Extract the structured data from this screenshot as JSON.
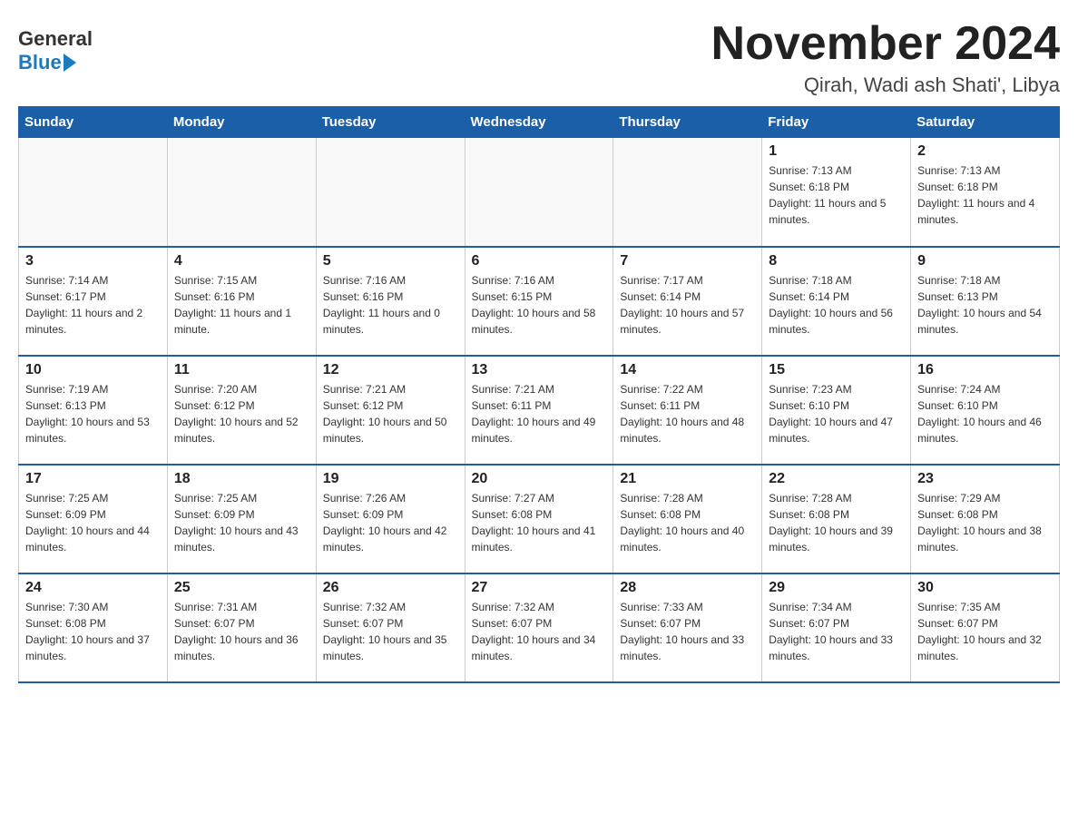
{
  "header": {
    "logo_general": "General",
    "logo_blue": "Blue",
    "month_title": "November 2024",
    "location": "Qirah, Wadi ash Shati', Libya"
  },
  "weekdays": [
    "Sunday",
    "Monday",
    "Tuesday",
    "Wednesday",
    "Thursday",
    "Friday",
    "Saturday"
  ],
  "weeks": [
    [
      {
        "day": "",
        "sunrise": "",
        "sunset": "",
        "daylight": ""
      },
      {
        "day": "",
        "sunrise": "",
        "sunset": "",
        "daylight": ""
      },
      {
        "day": "",
        "sunrise": "",
        "sunset": "",
        "daylight": ""
      },
      {
        "day": "",
        "sunrise": "",
        "sunset": "",
        "daylight": ""
      },
      {
        "day": "",
        "sunrise": "",
        "sunset": "",
        "daylight": ""
      },
      {
        "day": "1",
        "sunrise": "Sunrise: 7:13 AM",
        "sunset": "Sunset: 6:18 PM",
        "daylight": "Daylight: 11 hours and 5 minutes."
      },
      {
        "day": "2",
        "sunrise": "Sunrise: 7:13 AM",
        "sunset": "Sunset: 6:18 PM",
        "daylight": "Daylight: 11 hours and 4 minutes."
      }
    ],
    [
      {
        "day": "3",
        "sunrise": "Sunrise: 7:14 AM",
        "sunset": "Sunset: 6:17 PM",
        "daylight": "Daylight: 11 hours and 2 minutes."
      },
      {
        "day": "4",
        "sunrise": "Sunrise: 7:15 AM",
        "sunset": "Sunset: 6:16 PM",
        "daylight": "Daylight: 11 hours and 1 minute."
      },
      {
        "day": "5",
        "sunrise": "Sunrise: 7:16 AM",
        "sunset": "Sunset: 6:16 PM",
        "daylight": "Daylight: 11 hours and 0 minutes."
      },
      {
        "day": "6",
        "sunrise": "Sunrise: 7:16 AM",
        "sunset": "Sunset: 6:15 PM",
        "daylight": "Daylight: 10 hours and 58 minutes."
      },
      {
        "day": "7",
        "sunrise": "Sunrise: 7:17 AM",
        "sunset": "Sunset: 6:14 PM",
        "daylight": "Daylight: 10 hours and 57 minutes."
      },
      {
        "day": "8",
        "sunrise": "Sunrise: 7:18 AM",
        "sunset": "Sunset: 6:14 PM",
        "daylight": "Daylight: 10 hours and 56 minutes."
      },
      {
        "day": "9",
        "sunrise": "Sunrise: 7:18 AM",
        "sunset": "Sunset: 6:13 PM",
        "daylight": "Daylight: 10 hours and 54 minutes."
      }
    ],
    [
      {
        "day": "10",
        "sunrise": "Sunrise: 7:19 AM",
        "sunset": "Sunset: 6:13 PM",
        "daylight": "Daylight: 10 hours and 53 minutes."
      },
      {
        "day": "11",
        "sunrise": "Sunrise: 7:20 AM",
        "sunset": "Sunset: 6:12 PM",
        "daylight": "Daylight: 10 hours and 52 minutes."
      },
      {
        "day": "12",
        "sunrise": "Sunrise: 7:21 AM",
        "sunset": "Sunset: 6:12 PM",
        "daylight": "Daylight: 10 hours and 50 minutes."
      },
      {
        "day": "13",
        "sunrise": "Sunrise: 7:21 AM",
        "sunset": "Sunset: 6:11 PM",
        "daylight": "Daylight: 10 hours and 49 minutes."
      },
      {
        "day": "14",
        "sunrise": "Sunrise: 7:22 AM",
        "sunset": "Sunset: 6:11 PM",
        "daylight": "Daylight: 10 hours and 48 minutes."
      },
      {
        "day": "15",
        "sunrise": "Sunrise: 7:23 AM",
        "sunset": "Sunset: 6:10 PM",
        "daylight": "Daylight: 10 hours and 47 minutes."
      },
      {
        "day": "16",
        "sunrise": "Sunrise: 7:24 AM",
        "sunset": "Sunset: 6:10 PM",
        "daylight": "Daylight: 10 hours and 46 minutes."
      }
    ],
    [
      {
        "day": "17",
        "sunrise": "Sunrise: 7:25 AM",
        "sunset": "Sunset: 6:09 PM",
        "daylight": "Daylight: 10 hours and 44 minutes."
      },
      {
        "day": "18",
        "sunrise": "Sunrise: 7:25 AM",
        "sunset": "Sunset: 6:09 PM",
        "daylight": "Daylight: 10 hours and 43 minutes."
      },
      {
        "day": "19",
        "sunrise": "Sunrise: 7:26 AM",
        "sunset": "Sunset: 6:09 PM",
        "daylight": "Daylight: 10 hours and 42 minutes."
      },
      {
        "day": "20",
        "sunrise": "Sunrise: 7:27 AM",
        "sunset": "Sunset: 6:08 PM",
        "daylight": "Daylight: 10 hours and 41 minutes."
      },
      {
        "day": "21",
        "sunrise": "Sunrise: 7:28 AM",
        "sunset": "Sunset: 6:08 PM",
        "daylight": "Daylight: 10 hours and 40 minutes."
      },
      {
        "day": "22",
        "sunrise": "Sunrise: 7:28 AM",
        "sunset": "Sunset: 6:08 PM",
        "daylight": "Daylight: 10 hours and 39 minutes."
      },
      {
        "day": "23",
        "sunrise": "Sunrise: 7:29 AM",
        "sunset": "Sunset: 6:08 PM",
        "daylight": "Daylight: 10 hours and 38 minutes."
      }
    ],
    [
      {
        "day": "24",
        "sunrise": "Sunrise: 7:30 AM",
        "sunset": "Sunset: 6:08 PM",
        "daylight": "Daylight: 10 hours and 37 minutes."
      },
      {
        "day": "25",
        "sunrise": "Sunrise: 7:31 AM",
        "sunset": "Sunset: 6:07 PM",
        "daylight": "Daylight: 10 hours and 36 minutes."
      },
      {
        "day": "26",
        "sunrise": "Sunrise: 7:32 AM",
        "sunset": "Sunset: 6:07 PM",
        "daylight": "Daylight: 10 hours and 35 minutes."
      },
      {
        "day": "27",
        "sunrise": "Sunrise: 7:32 AM",
        "sunset": "Sunset: 6:07 PM",
        "daylight": "Daylight: 10 hours and 34 minutes."
      },
      {
        "day": "28",
        "sunrise": "Sunrise: 7:33 AM",
        "sunset": "Sunset: 6:07 PM",
        "daylight": "Daylight: 10 hours and 33 minutes."
      },
      {
        "day": "29",
        "sunrise": "Sunrise: 7:34 AM",
        "sunset": "Sunset: 6:07 PM",
        "daylight": "Daylight: 10 hours and 33 minutes."
      },
      {
        "day": "30",
        "sunrise": "Sunrise: 7:35 AM",
        "sunset": "Sunset: 6:07 PM",
        "daylight": "Daylight: 10 hours and 32 minutes."
      }
    ]
  ]
}
